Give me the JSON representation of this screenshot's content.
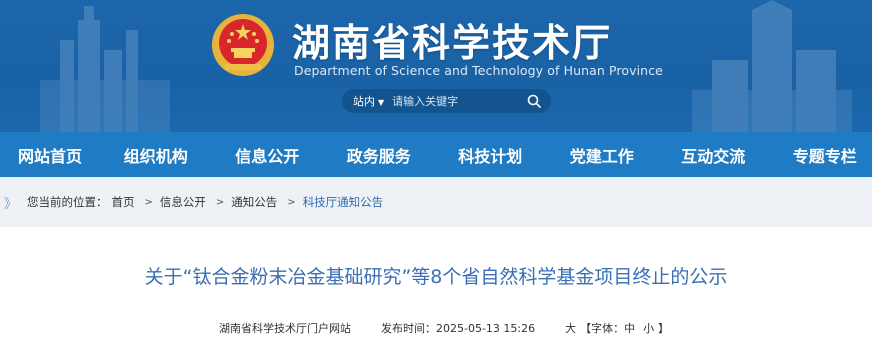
{
  "header": {
    "title": "湖南省科学技术厅",
    "subtitle": "Department of Science and Technology of Hunan Province",
    "emblem_icon": "national-emblem-icon"
  },
  "search": {
    "scope": "站内",
    "placeholder": "请输入关键字"
  },
  "nav": {
    "items": [
      "网站首页",
      "组织机构",
      "信息公开",
      "政务服务",
      "科技计划",
      "党建工作",
      "互动交流",
      "专题专栏"
    ]
  },
  "breadcrumb": {
    "prefix": "您当前的位置：",
    "items": [
      "首页",
      "信息公开",
      "通知公告",
      "科技厅通知公告"
    ],
    "separator": ">"
  },
  "article": {
    "title": "关于“钛合金粉末冶金基础研究”等8个省自然科学基金项目终止的公示",
    "source": "湖南省科学技术厅门户网站",
    "date_label": "发布时间：",
    "date": "2025-05-13 15:26",
    "font_controls": {
      "large": "大",
      "bracket_open": "【字体：",
      "medium": "中",
      "small": "小",
      "bracket_close": "】"
    }
  },
  "colors": {
    "header_bg": "#1a62a6",
    "nav_bg": "#1f7cc4",
    "title_blue": "#3b6fb4",
    "crumb_bg": "#eef1f5"
  }
}
